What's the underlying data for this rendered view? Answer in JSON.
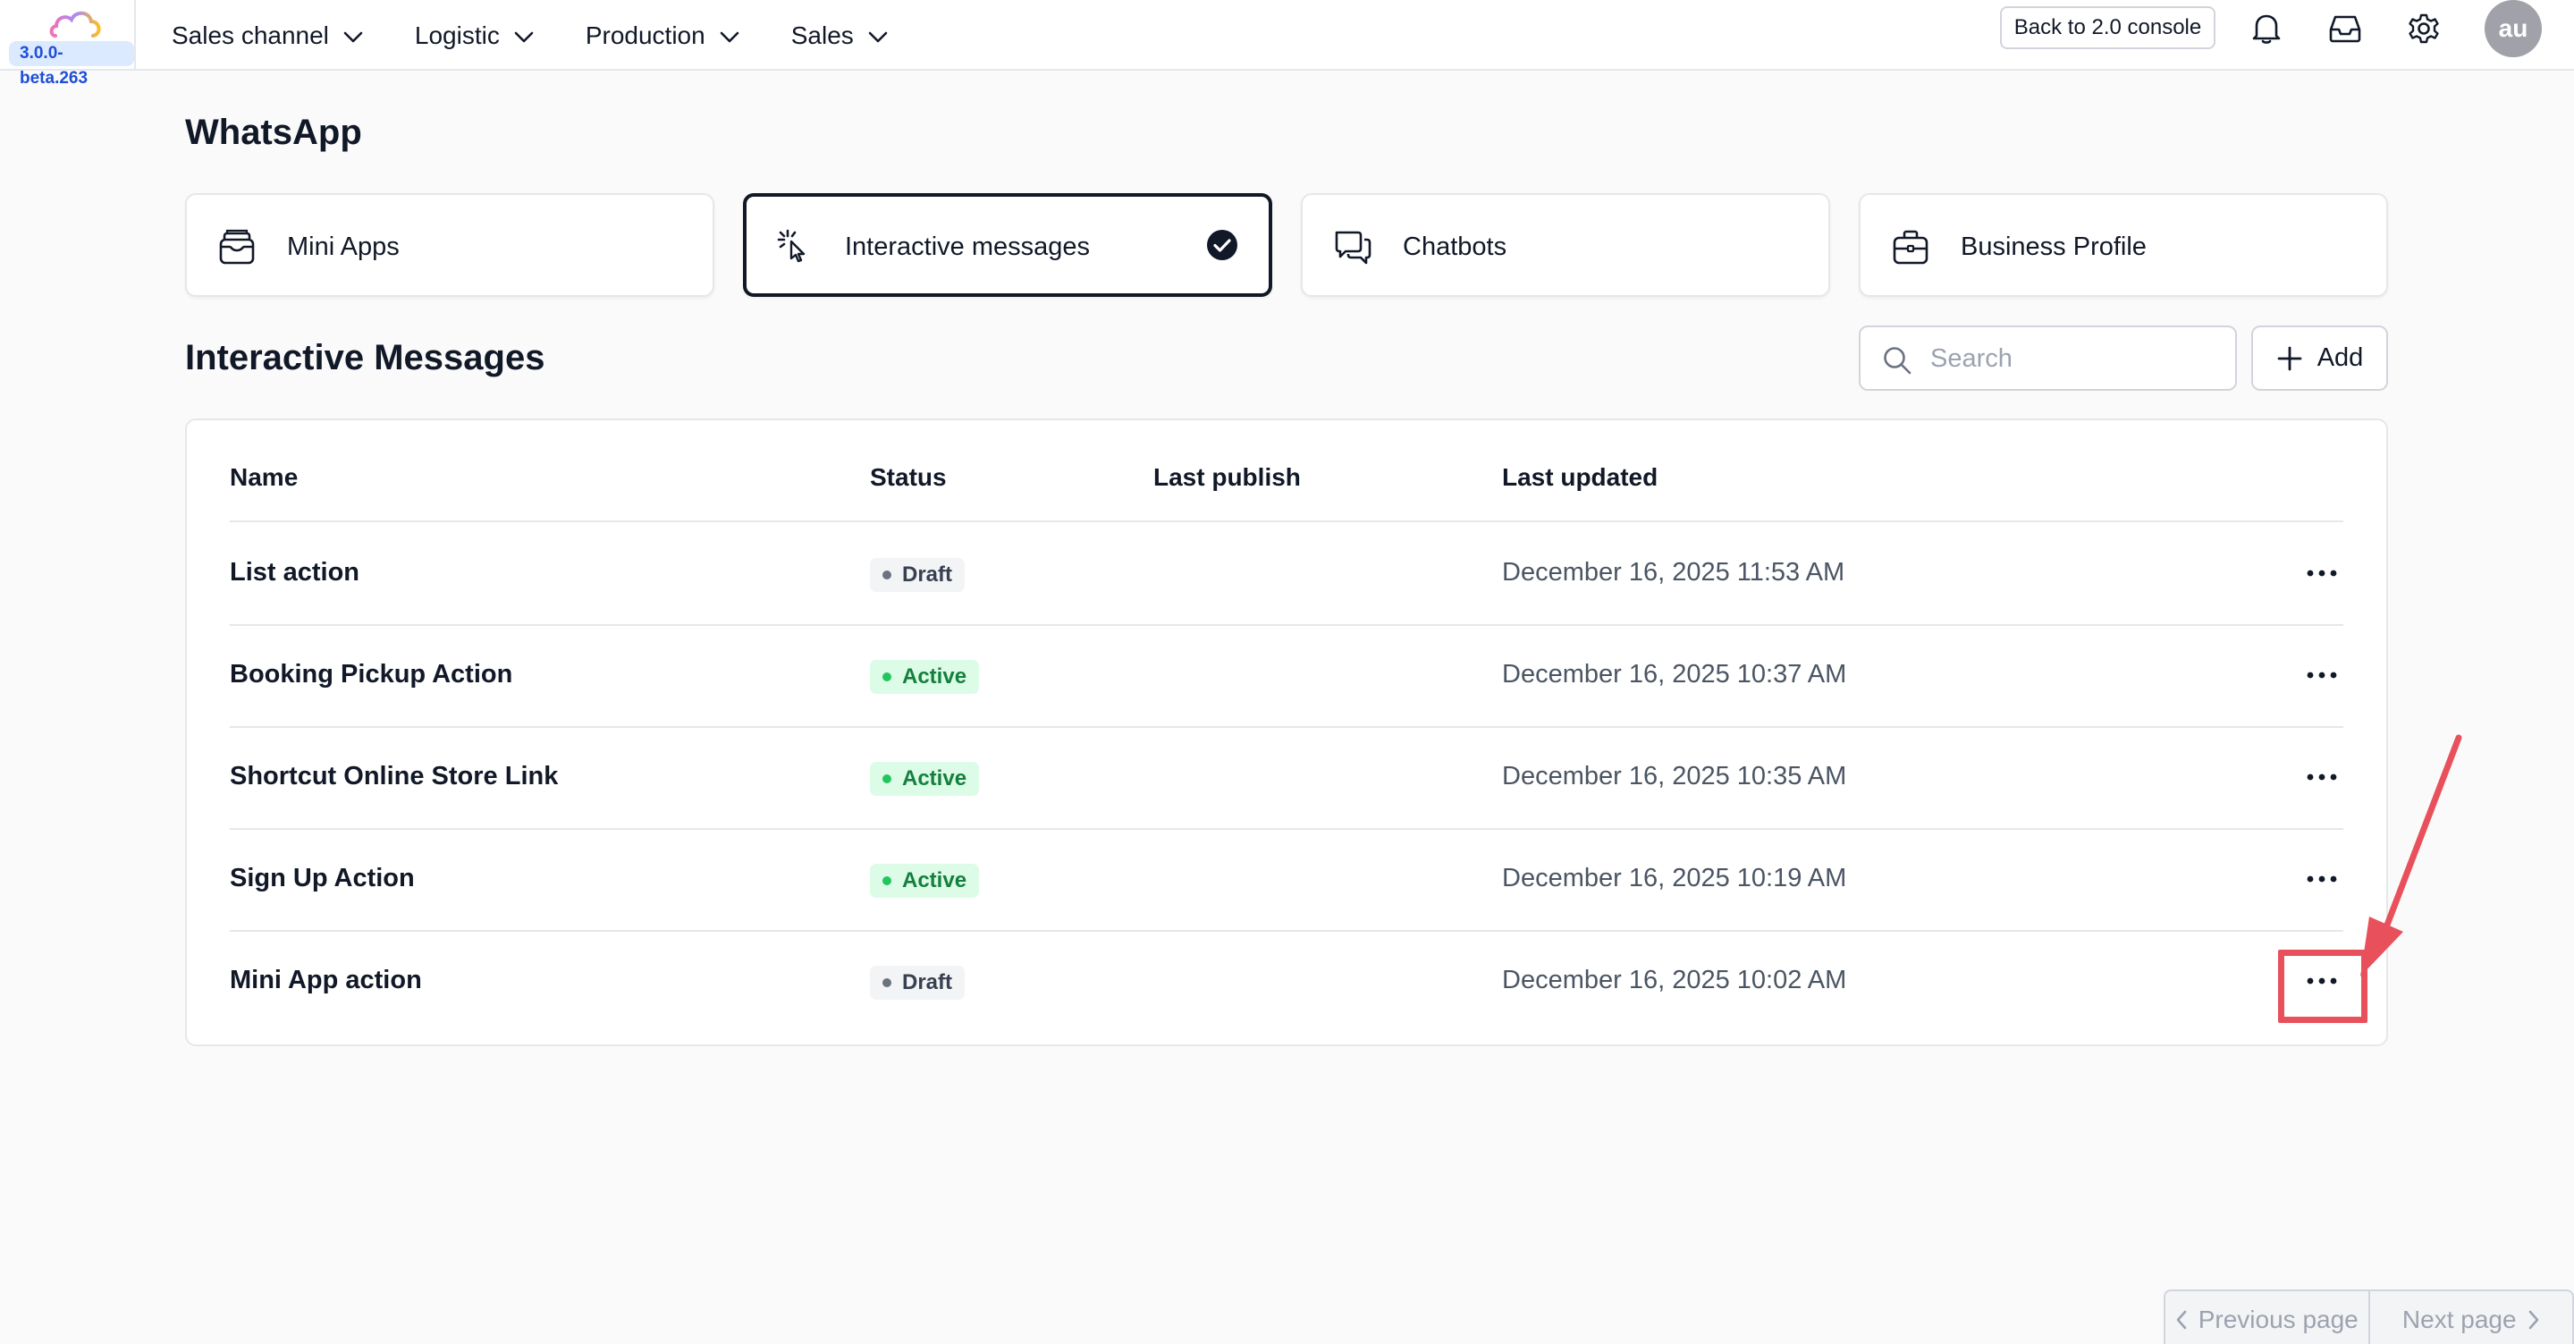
{
  "app": {
    "version": "3.0.0-beta.263"
  },
  "nav": {
    "items": [
      {
        "label": "Sales channel"
      },
      {
        "label": "Logistic"
      },
      {
        "label": "Production"
      },
      {
        "label": "Sales"
      }
    ],
    "back_button": "Back to 2.0 console",
    "avatar_initials": "au",
    "icons": [
      "bell-icon",
      "inbox-icon",
      "gear-icon"
    ]
  },
  "page": {
    "title": "WhatsApp"
  },
  "cards": [
    {
      "label": "Mini Apps",
      "icon": "wallet-icon",
      "selected": false
    },
    {
      "label": "Interactive messages",
      "icon": "cursor-click-icon",
      "selected": true
    },
    {
      "label": "Chatbots",
      "icon": "chat-bubbles-icon",
      "selected": false
    },
    {
      "label": "Business Profile",
      "icon": "briefcase-icon",
      "selected": false
    }
  ],
  "section": {
    "title": "Interactive Messages",
    "search_placeholder": "Search",
    "add_label": "Add"
  },
  "table": {
    "columns": {
      "name": "Name",
      "status": "Status",
      "last_publish": "Last publish",
      "last_updated": "Last updated"
    },
    "rows": [
      {
        "name": "List action",
        "status": "Draft",
        "last_publish": "",
        "last_updated": "December 16, 2025 11:53 AM"
      },
      {
        "name": "Booking Pickup Action",
        "status": "Active",
        "last_publish": "",
        "last_updated": "December 16, 2025 10:37 AM"
      },
      {
        "name": "Shortcut Online Store Link",
        "status": "Active",
        "last_publish": "",
        "last_updated": "December 16, 2025 10:35 AM"
      },
      {
        "name": "Sign Up Action",
        "status": "Active",
        "last_publish": "",
        "last_updated": "December 16, 2025 10:19 AM"
      },
      {
        "name": "Mini App action",
        "status": "Draft",
        "last_publish": "",
        "last_updated": "December 16, 2025 10:02 AM"
      }
    ]
  },
  "pagination": {
    "prev": "Previous page",
    "next": "Next page"
  },
  "colors": {
    "draft_badge_bg": "#f3f4f6",
    "active_badge_bg": "#dcfce7",
    "active_text": "#15803d",
    "annotation": "#e8505b"
  }
}
